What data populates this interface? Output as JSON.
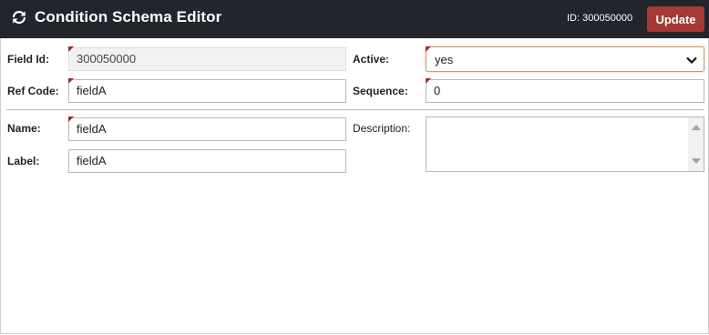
{
  "header": {
    "title": "Condition Schema Editor",
    "id_text": "ID: 300050000",
    "update_label": "Update",
    "icon": "refresh-icon",
    "colors": {
      "bar": "#22252b",
      "update_button": "#a33a35"
    }
  },
  "form": {
    "field_id": {
      "label": "Field Id:",
      "value": "300050000"
    },
    "active": {
      "label": "Active:",
      "value": "yes"
    },
    "ref_code": {
      "label": "Ref Code:",
      "value": "fieldA"
    },
    "sequence": {
      "label": "Sequence:",
      "value": "0"
    },
    "name": {
      "label": "Name:",
      "value": "fieldA"
    },
    "description": {
      "label": "Description:",
      "value": ""
    },
    "label_field": {
      "label": "Label:",
      "value": "fieldA"
    }
  }
}
